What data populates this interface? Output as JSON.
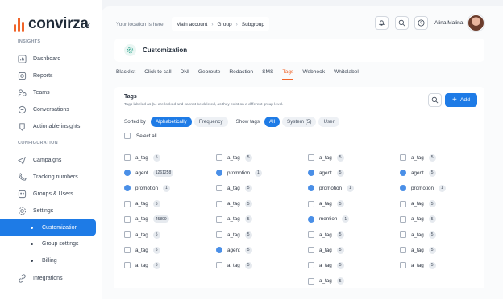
{
  "brand": {
    "name": "convirza",
    "accent": "#f0652a",
    "primary": "#1e7be6"
  },
  "sidebar": {
    "sections": {
      "insights": "INSIGHTS",
      "configuration": "CONFIGURATION"
    },
    "items": [
      {
        "label": "Dashboard",
        "icon": "chart-icon"
      },
      {
        "label": "Reports",
        "icon": "report-icon"
      },
      {
        "label": "Teams",
        "icon": "teams-icon"
      },
      {
        "label": "Conversations",
        "icon": "chat-icon"
      },
      {
        "label": "Actionable insights",
        "icon": "bulb-icon"
      },
      {
        "label": "Campaigns",
        "icon": "campaign-icon"
      },
      {
        "label": "Tracking numbers",
        "icon": "phone-icon"
      },
      {
        "label": "Groups & Users",
        "icon": "groups-icon"
      },
      {
        "label": "Settings",
        "icon": "gear-icon"
      },
      {
        "label": "Customization",
        "icon": "dot"
      },
      {
        "label": "Group settings",
        "icon": "dot"
      },
      {
        "label": "Billing",
        "icon": "dot"
      },
      {
        "label": "Integrations",
        "icon": "link-icon"
      }
    ]
  },
  "topbar": {
    "location_label": "Your location is here",
    "breadcrumb": [
      "Main account",
      "Group",
      "Subgroup"
    ],
    "user_name": "Alina Malina"
  },
  "page": {
    "title": "Customization"
  },
  "tabs": [
    "Blacklist",
    "Click to call",
    "DNI",
    "Georoute",
    "Redaction",
    "SMS",
    "Tags",
    "Webhook",
    "Whitelabel"
  ],
  "active_tab": "Tags",
  "panel": {
    "title": "Tags",
    "note": "Tags labeled as (L) are locked and cannot be deleted, as they exist on a different group level.",
    "add_label": "Add",
    "sorted_by_label": "Sorted by",
    "sort_options": [
      "Alphabetically",
      "Frequency"
    ],
    "show_tags_label": "Show tags",
    "show_options": [
      "All",
      "System (5)",
      "User"
    ],
    "select_all_label": "Select all"
  },
  "tag_columns": [
    [
      {
        "name": "a_tag",
        "count": "5",
        "type": "checkbox"
      },
      {
        "name": "agent",
        "count": "1261258",
        "type": "system"
      },
      {
        "name": "promotion",
        "count": "1",
        "type": "system"
      },
      {
        "name": "a_tag",
        "count": "5",
        "type": "checkbox"
      },
      {
        "name": "a_tag",
        "count": "45899",
        "type": "checkbox"
      },
      {
        "name": "a_tag",
        "count": "5",
        "type": "checkbox"
      },
      {
        "name": "a_tag",
        "count": "5",
        "type": "checkbox"
      },
      {
        "name": "a_tag",
        "count": "5",
        "type": "checkbox"
      }
    ],
    [
      {
        "name": "a_tag",
        "count": "5",
        "type": "checkbox"
      },
      {
        "name": "promotion",
        "count": "1",
        "type": "system"
      },
      {
        "name": "a_tag",
        "count": "5",
        "type": "checkbox"
      },
      {
        "name": "a_tag",
        "count": "5",
        "type": "checkbox"
      },
      {
        "name": "a_tag",
        "count": "5",
        "type": "checkbox"
      },
      {
        "name": "a_tag",
        "count": "5",
        "type": "checkbox"
      },
      {
        "name": "agent",
        "count": "5",
        "type": "system"
      },
      {
        "name": "a_tag",
        "count": "5",
        "type": "checkbox"
      }
    ],
    [
      {
        "name": "a_tag",
        "count": "5",
        "type": "checkbox"
      },
      {
        "name": "agent",
        "count": "5",
        "type": "system"
      },
      {
        "name": "promotion",
        "count": "1",
        "type": "system"
      },
      {
        "name": "a_tag",
        "count": "5",
        "type": "checkbox"
      },
      {
        "name": "mention",
        "count": "1",
        "type": "system"
      },
      {
        "name": "a_tag",
        "count": "5",
        "type": "checkbox"
      },
      {
        "name": "a_tag",
        "count": "5",
        "type": "checkbox"
      },
      {
        "name": "a_tag",
        "count": "5",
        "type": "checkbox"
      },
      {
        "name": "a_tag",
        "count": "5",
        "type": "checkbox"
      }
    ],
    [
      {
        "name": "a_tag",
        "count": "5",
        "type": "checkbox"
      },
      {
        "name": "agent",
        "count": "5",
        "type": "system"
      },
      {
        "name": "promotion",
        "count": "1",
        "type": "system"
      },
      {
        "name": "a_tag",
        "count": "5",
        "type": "checkbox"
      },
      {
        "name": "a_tag",
        "count": "5",
        "type": "checkbox"
      },
      {
        "name": "a_tag",
        "count": "5",
        "type": "checkbox"
      },
      {
        "name": "a_tag",
        "count": "5",
        "type": "checkbox"
      },
      {
        "name": "a_tag",
        "count": "5",
        "type": "checkbox"
      }
    ]
  ]
}
